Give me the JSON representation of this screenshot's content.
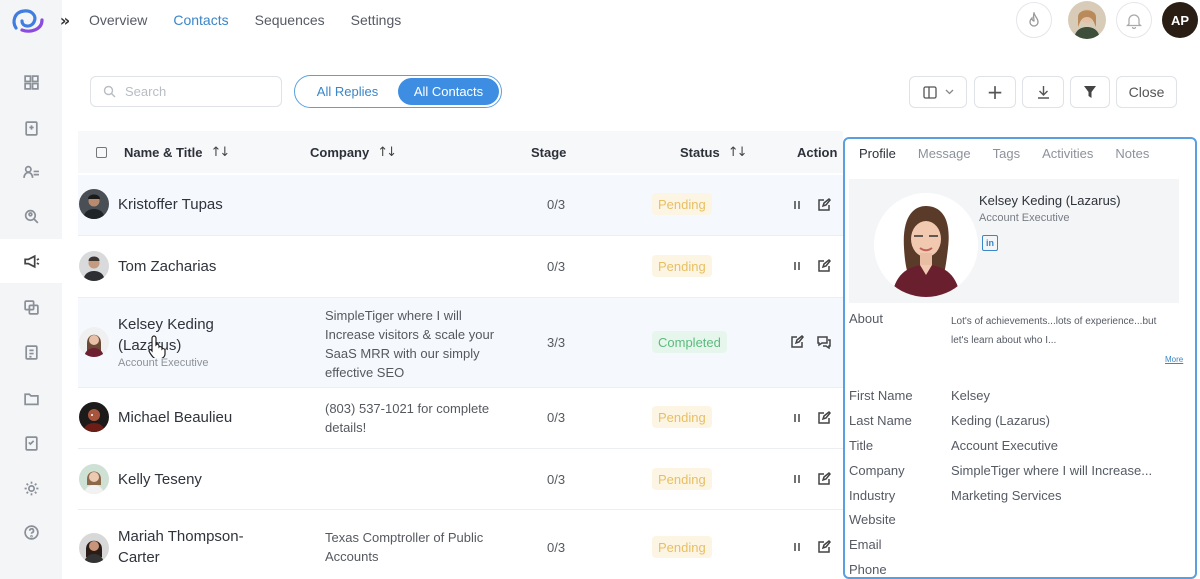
{
  "nav": {
    "expand_glyph": "»",
    "tabs": [
      {
        "label": "Overview",
        "active": false
      },
      {
        "label": "Contacts",
        "active": true
      },
      {
        "label": "Sequences",
        "active": false
      },
      {
        "label": "Settings",
        "active": false
      }
    ],
    "user_initials": "AP"
  },
  "sidebar": {
    "items": [
      {
        "icon": "dashboard-icon"
      },
      {
        "icon": "document-icon"
      },
      {
        "icon": "contacts-icon"
      },
      {
        "icon": "search-people-icon"
      },
      {
        "icon": "campaign-icon",
        "active": true
      },
      {
        "icon": "templates-icon"
      },
      {
        "icon": "reports-icon"
      },
      {
        "icon": "folder-icon"
      },
      {
        "icon": "tasks-icon"
      },
      {
        "icon": "settings-icon"
      },
      {
        "icon": "help-icon"
      }
    ]
  },
  "toolbar": {
    "search_placeholder": "Search",
    "segment": {
      "option1": "All Replies",
      "option2": "All Contacts",
      "selected": "All Contacts"
    },
    "close_label": "Close",
    "add_glyph": "+"
  },
  "table": {
    "headers": {
      "name": "Name & Title",
      "company": "Company",
      "stage": "Stage",
      "status": "Status",
      "action": "Action"
    },
    "sort_glyph": "↑↓",
    "rows": [
      {
        "name": "Kristoffer Tupas",
        "subtitle": "",
        "company": "",
        "stage": "0/3",
        "status": "Pending",
        "actions": [
          "pause-icon",
          "edit-icon"
        ]
      },
      {
        "name": "Tom Zacharias",
        "subtitle": "",
        "company": "",
        "stage": "0/3",
        "status": "Pending",
        "actions": [
          "pause-icon",
          "edit-icon"
        ]
      },
      {
        "name": "Kelsey Keding (Lazarus)",
        "subtitle": "Account Executive",
        "company": "SimpleTiger where I will Increase visitors & scale your SaaS MRR with our simply effective SEO",
        "stage": "3/3",
        "status": "Completed",
        "actions": [
          "edit-icon",
          "chat-icon"
        ]
      },
      {
        "name": "Michael Beaulieu",
        "subtitle": "",
        "company": "(803) 537-1021 for complete details!",
        "stage": "0/3",
        "status": "Pending",
        "actions": [
          "pause-icon",
          "edit-icon"
        ]
      },
      {
        "name": "Kelly Teseny",
        "subtitle": "",
        "company": "",
        "stage": "0/3",
        "status": "Pending",
        "actions": [
          "pause-icon",
          "edit-icon"
        ]
      },
      {
        "name": "Mariah Thompson-Carter",
        "subtitle": "",
        "company": "Texas Comptroller of Public Accounts",
        "stage": "0/3",
        "status": "Pending",
        "actions": [
          "pause-icon",
          "edit-icon"
        ]
      }
    ]
  },
  "profile": {
    "tabs": [
      "Profile",
      "Message",
      "Tags",
      "Activities",
      "Notes"
    ],
    "active_tab": "Profile",
    "name": "Kelsey Keding (Lazarus)",
    "title": "Account Executive",
    "linkedin_glyph": "in",
    "about_label": "About",
    "about_text": "Lot's of achievements...lots of experience...but let's learn about who I...",
    "more_label": "More",
    "fields": [
      {
        "label": "First Name",
        "value": "Kelsey"
      },
      {
        "label": "Last Name",
        "value": "Keding (Lazarus)"
      },
      {
        "label": "Title",
        "value": "Account Executive"
      },
      {
        "label": "Company",
        "value": "SimpleTiger where I will Increase..."
      },
      {
        "label": "Industry",
        "value": "Marketing Services"
      },
      {
        "label": "Website",
        "value": ""
      },
      {
        "label": "Email",
        "value": ""
      },
      {
        "label": "Phone",
        "value": ""
      }
    ]
  },
  "colors": {
    "accent": "#3d8ee3",
    "pending_bg": "#fdf5e3",
    "pending_text": "#e7bf63",
    "completed_bg": "#e7f6ec",
    "completed_text": "#5bbb7e"
  }
}
